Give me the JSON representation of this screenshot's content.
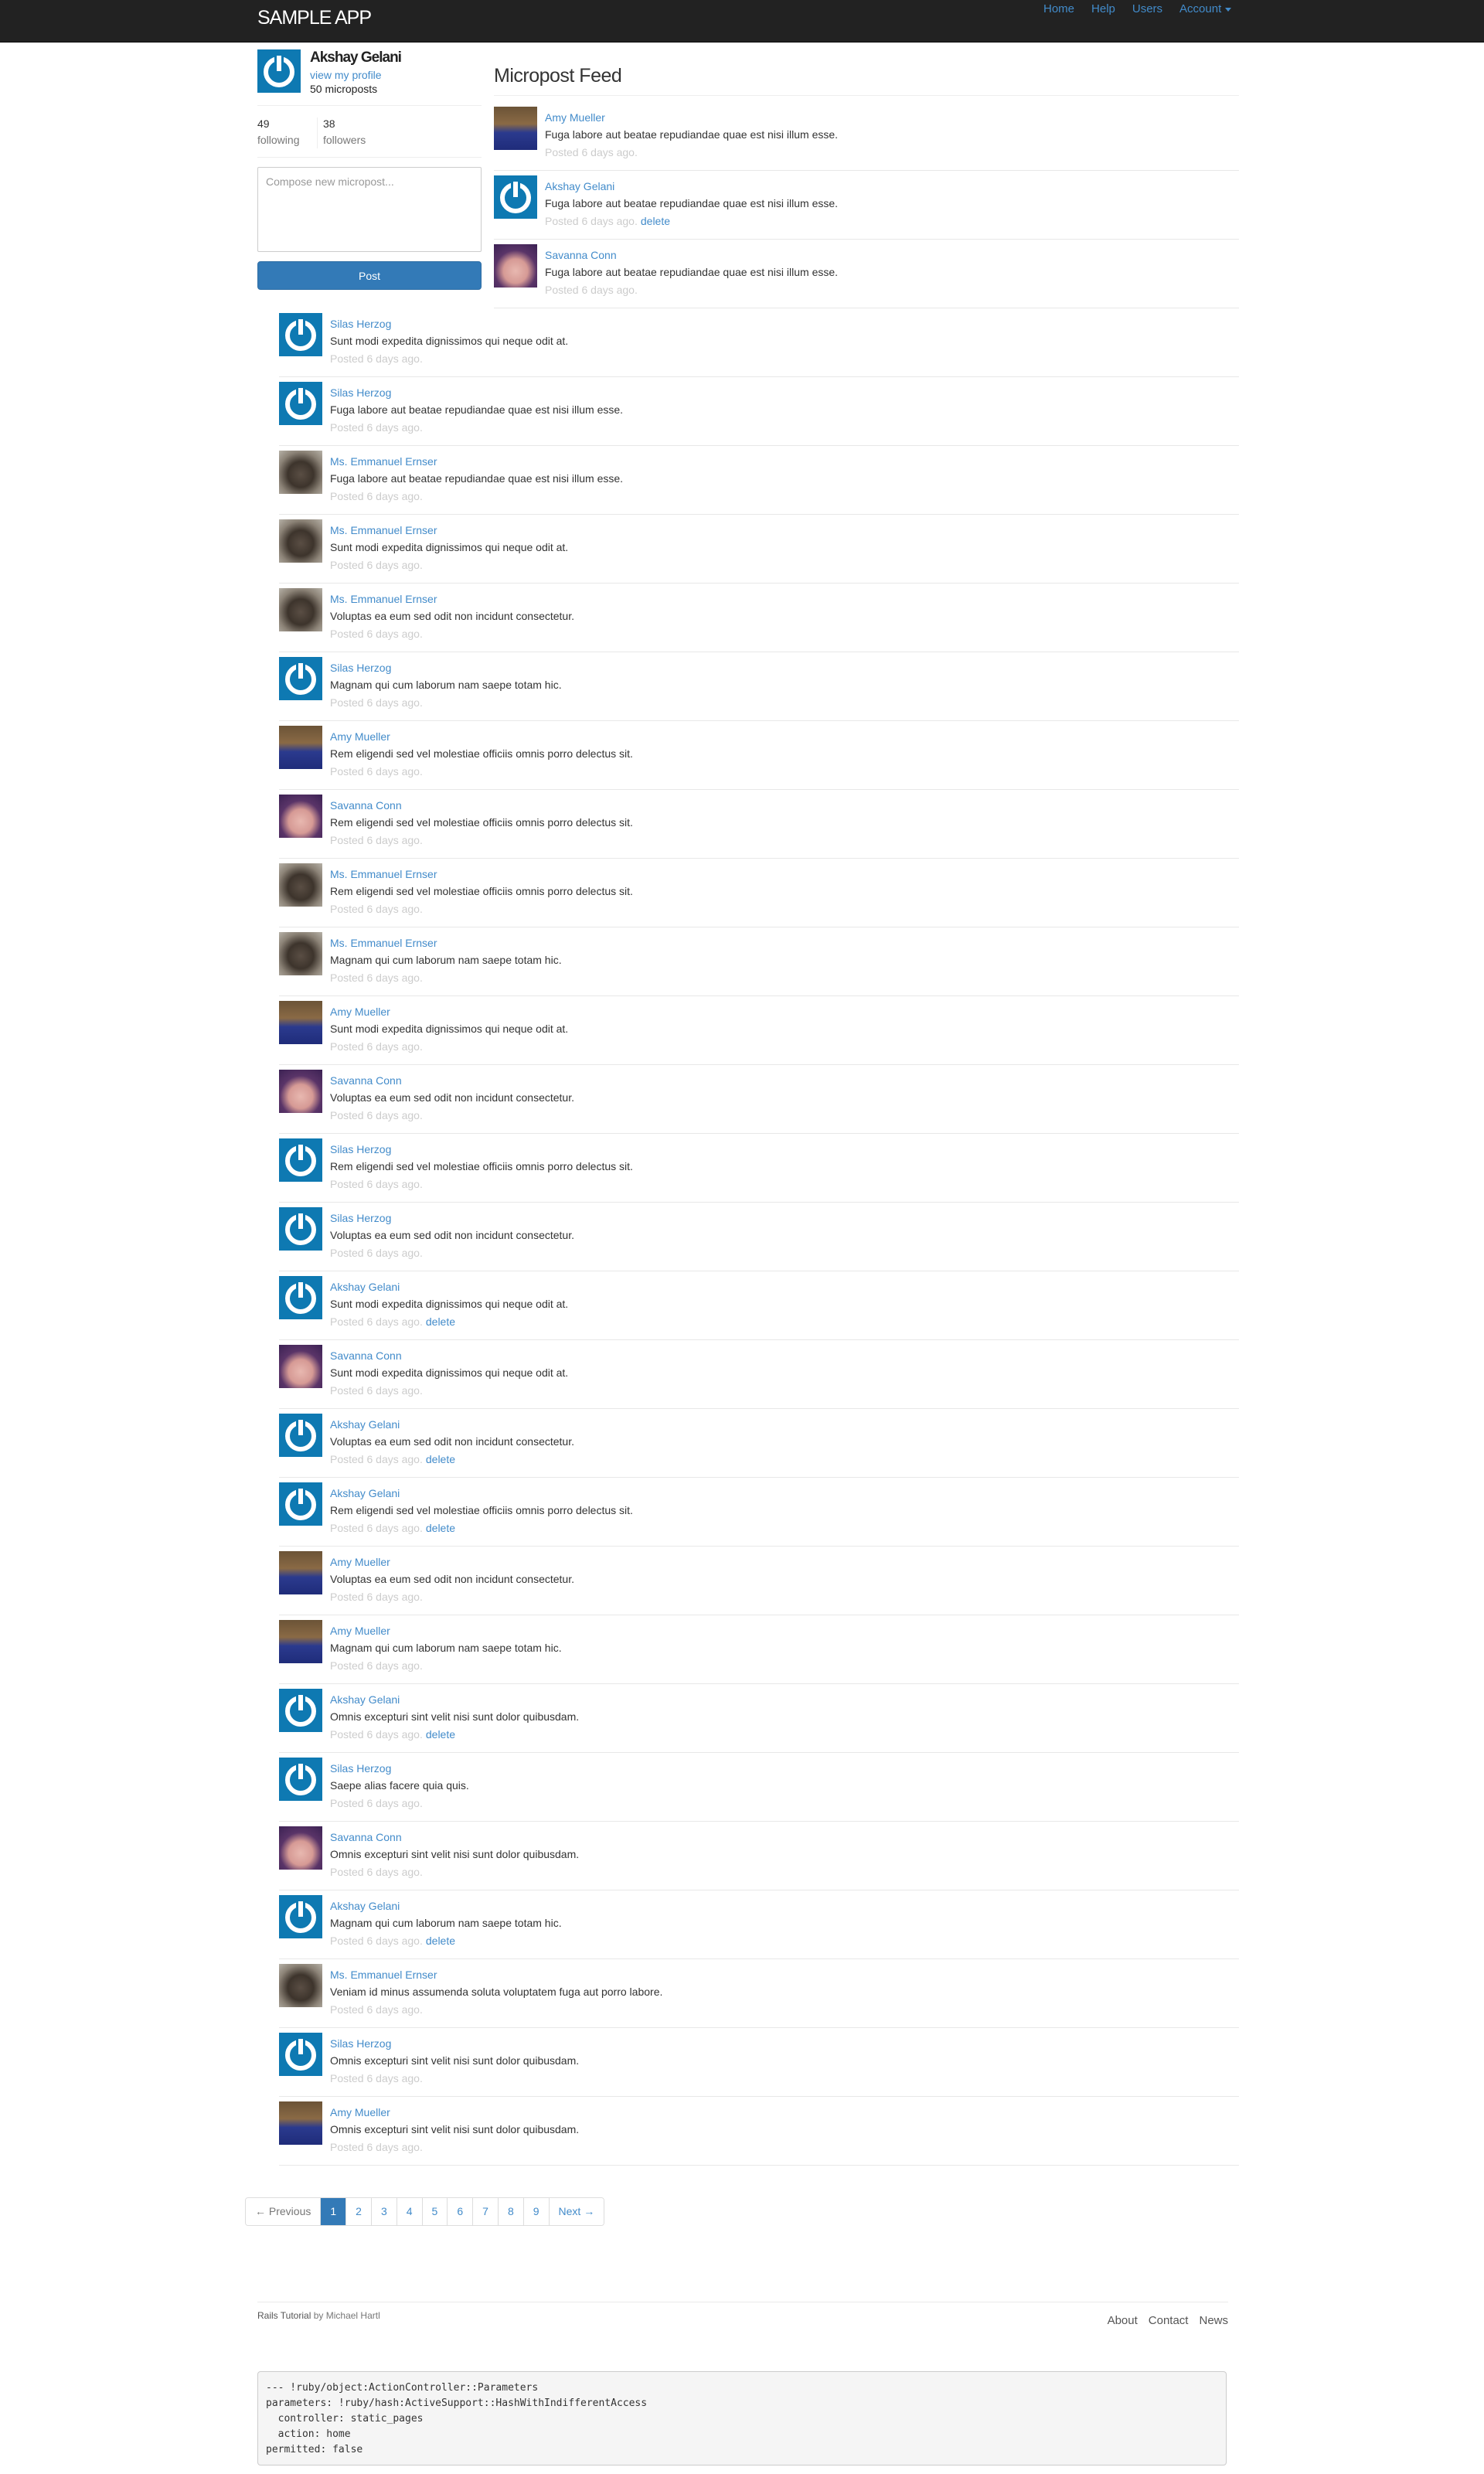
{
  "nav": {
    "logo": "SAMPLE APP",
    "links": [
      "Home",
      "Help",
      "Users",
      "Account"
    ]
  },
  "user": {
    "name": "Akshay Gelani",
    "profile_link": "view my profile",
    "micropost_count": "50 microposts",
    "avatar": "gravatar-power-icon"
  },
  "stats": {
    "following_count": "49",
    "following_label": "following",
    "followers_count": "38",
    "followers_label": "followers"
  },
  "compose": {
    "placeholder": "Compose new micropost...",
    "button": "Post"
  },
  "feed": {
    "title": "Micropost Feed",
    "delete_label": "delete",
    "posts": [
      {
        "user": "Amy Mueller",
        "content": "Fuga labore aut beatae repudiandae quae est nisi illum esse.",
        "time": "Posted 6 days ago.",
        "deletable": false,
        "avatar": "amy"
      },
      {
        "user": "Akshay Gelani",
        "content": "Fuga labore aut beatae repudiandae quae est nisi illum esse.",
        "time": "Posted 6 days ago.",
        "deletable": true,
        "avatar": "gravatar"
      },
      {
        "user": "Savanna Conn",
        "content": "Fuga labore aut beatae repudiandae quae est nisi illum esse.",
        "time": "Posted 6 days ago.",
        "deletable": false,
        "avatar": "savanna"
      },
      {
        "user": "Silas Herzog",
        "content": "Sunt modi expedita dignissimos qui neque odit at.",
        "time": "Posted 6 days ago.",
        "deletable": false,
        "avatar": "gravatar"
      },
      {
        "user": "Silas Herzog",
        "content": "Fuga labore aut beatae repudiandae quae est nisi illum esse.",
        "time": "Posted 6 days ago.",
        "deletable": false,
        "avatar": "gravatar"
      },
      {
        "user": "Ms. Emmanuel Ernser",
        "content": "Fuga labore aut beatae repudiandae quae est nisi illum esse.",
        "time": "Posted 6 days ago.",
        "deletable": false,
        "avatar": "cat"
      },
      {
        "user": "Ms. Emmanuel Ernser",
        "content": "Sunt modi expedita dignissimos qui neque odit at.",
        "time": "Posted 6 days ago.",
        "deletable": false,
        "avatar": "cat"
      },
      {
        "user": "Ms. Emmanuel Ernser",
        "content": "Voluptas ea eum sed odit non incidunt consectetur.",
        "time": "Posted 6 days ago.",
        "deletable": false,
        "avatar": "cat"
      },
      {
        "user": "Silas Herzog",
        "content": "Magnam qui cum laborum nam saepe totam hic.",
        "time": "Posted 6 days ago.",
        "deletable": false,
        "avatar": "gravatar"
      },
      {
        "user": "Amy Mueller",
        "content": "Rem eligendi sed vel molestiae officiis omnis porro delectus sit.",
        "time": "Posted 6 days ago.",
        "deletable": false,
        "avatar": "amy"
      },
      {
        "user": "Savanna Conn",
        "content": "Rem eligendi sed vel molestiae officiis omnis porro delectus sit.",
        "time": "Posted 6 days ago.",
        "deletable": false,
        "avatar": "savanna"
      },
      {
        "user": "Ms. Emmanuel Ernser",
        "content": "Rem eligendi sed vel molestiae officiis omnis porro delectus sit.",
        "time": "Posted 6 days ago.",
        "deletable": false,
        "avatar": "cat"
      },
      {
        "user": "Ms. Emmanuel Ernser",
        "content": "Magnam qui cum laborum nam saepe totam hic.",
        "time": "Posted 6 days ago.",
        "deletable": false,
        "avatar": "cat"
      },
      {
        "user": "Amy Mueller",
        "content": "Sunt modi expedita dignissimos qui neque odit at.",
        "time": "Posted 6 days ago.",
        "deletable": false,
        "avatar": "amy"
      },
      {
        "user": "Savanna Conn",
        "content": "Voluptas ea eum sed odit non incidunt consectetur.",
        "time": "Posted 6 days ago.",
        "deletable": false,
        "avatar": "savanna"
      },
      {
        "user": "Silas Herzog",
        "content": "Rem eligendi sed vel molestiae officiis omnis porro delectus sit.",
        "time": "Posted 6 days ago.",
        "deletable": false,
        "avatar": "gravatar"
      },
      {
        "user": "Silas Herzog",
        "content": "Voluptas ea eum sed odit non incidunt consectetur.",
        "time": "Posted 6 days ago.",
        "deletable": false,
        "avatar": "gravatar"
      },
      {
        "user": "Akshay Gelani",
        "content": "Sunt modi expedita dignissimos qui neque odit at.",
        "time": "Posted 6 days ago.",
        "deletable": true,
        "avatar": "gravatar"
      },
      {
        "user": "Savanna Conn",
        "content": "Sunt modi expedita dignissimos qui neque odit at.",
        "time": "Posted 6 days ago.",
        "deletable": false,
        "avatar": "savanna"
      },
      {
        "user": "Akshay Gelani",
        "content": "Voluptas ea eum sed odit non incidunt consectetur.",
        "time": "Posted 6 days ago.",
        "deletable": true,
        "avatar": "gravatar"
      },
      {
        "user": "Akshay Gelani",
        "content": "Rem eligendi sed vel molestiae officiis omnis porro delectus sit.",
        "time": "Posted 6 days ago.",
        "deletable": true,
        "avatar": "gravatar"
      },
      {
        "user": "Amy Mueller",
        "content": "Voluptas ea eum sed odit non incidunt consectetur.",
        "time": "Posted 6 days ago.",
        "deletable": false,
        "avatar": "amy"
      },
      {
        "user": "Amy Mueller",
        "content": "Magnam qui cum laborum nam saepe totam hic.",
        "time": "Posted 6 days ago.",
        "deletable": false,
        "avatar": "amy"
      },
      {
        "user": "Akshay Gelani",
        "content": "Omnis excepturi sint velit nisi sunt dolor quibusdam.",
        "time": "Posted 6 days ago.",
        "deletable": true,
        "avatar": "gravatar"
      },
      {
        "user": "Silas Herzog",
        "content": "Saepe alias facere quia quis.",
        "time": "Posted 6 days ago.",
        "deletable": false,
        "avatar": "gravatar"
      },
      {
        "user": "Savanna Conn",
        "content": "Omnis excepturi sint velit nisi sunt dolor quibusdam.",
        "time": "Posted 6 days ago.",
        "deletable": false,
        "avatar": "savanna"
      },
      {
        "user": "Akshay Gelani",
        "content": "Magnam qui cum laborum nam saepe totam hic.",
        "time": "Posted 6 days ago.",
        "deletable": true,
        "avatar": "gravatar"
      },
      {
        "user": "Ms. Emmanuel Ernser",
        "content": "Veniam id minus assumenda soluta voluptatem fuga aut porro labore.",
        "time": "Posted 6 days ago.",
        "deletable": false,
        "avatar": "cat"
      },
      {
        "user": "Silas Herzog",
        "content": "Omnis excepturi sint velit nisi sunt dolor quibusdam.",
        "time": "Posted 6 days ago.",
        "deletable": false,
        "avatar": "gravatar"
      },
      {
        "user": "Amy Mueller",
        "content": "Omnis excepturi sint velit nisi sunt dolor quibusdam.",
        "time": "Posted 6 days ago.",
        "deletable": false,
        "avatar": "amy"
      }
    ]
  },
  "pagination": {
    "previous": "← Previous",
    "pages": [
      "1",
      "2",
      "3",
      "4",
      "5",
      "6",
      "7",
      "8",
      "9"
    ],
    "current": "1",
    "next": "Next →"
  },
  "footer": {
    "brand": "Rails Tutorial",
    "author_prefix": "by",
    "author": "Michael Hartl",
    "links": [
      "About",
      "Contact",
      "News"
    ]
  },
  "debug": "--- !ruby/object:ActionController::Parameters\nparameters: !ruby/hash:ActiveSupport::HashWithIndifferentAccess\n  controller: static_pages\n  action: home\npermitted: false",
  "colors": {
    "navbar": "#222222",
    "link": "#428bca",
    "button": "#337ab7",
    "gravatar": "#0e79b2",
    "timestamp": "#cccccc"
  }
}
